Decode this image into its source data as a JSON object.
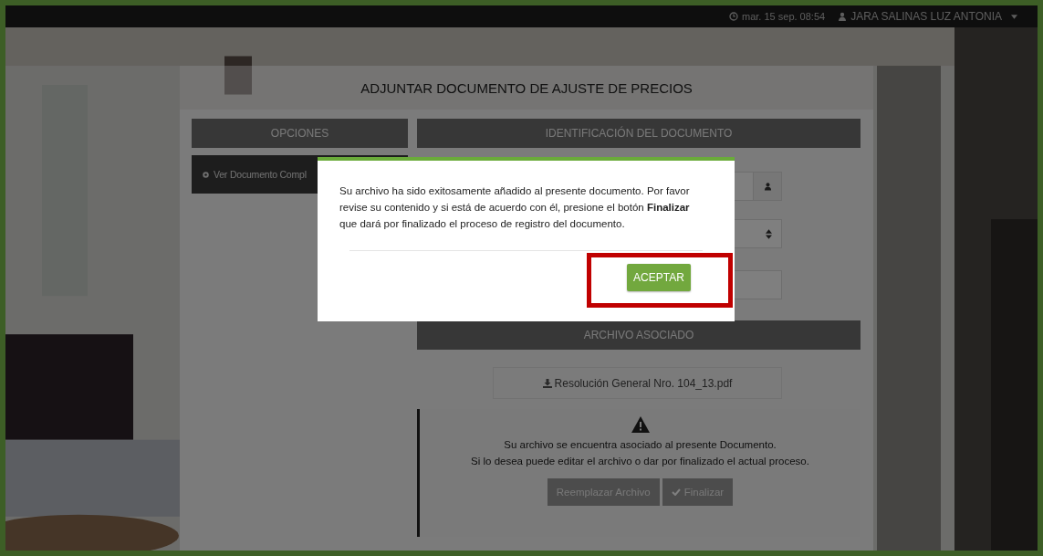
{
  "top_bar": {
    "datetime": "mar. 15 sep. 08:54",
    "user": "JARA SALINAS LUZ ANTONIA"
  },
  "page": {
    "title": "ADJUNTAR DOCUMENTO DE AJUSTE DE PRECIOS"
  },
  "options": {
    "header": "OPCIONES",
    "items": [
      {
        "label": "Ver Documento Compl"
      }
    ]
  },
  "identification": {
    "header": "IDENTIFICACIÓN DEL DOCUMENTO",
    "fields": [
      {
        "kind": "user"
      },
      {
        "kind": "select"
      },
      {
        "kind": "text"
      }
    ]
  },
  "attachment": {
    "header": "ARCHIVO ASOCIADO",
    "file": "Resolución General Nro. 104_13.pdf",
    "notice": [
      "Su archivo se encuentra asociado al presente Documento.",
      "Si lo desea puede editar el archivo o dar por finalizado el actual proceso."
    ],
    "buttons": [
      {
        "kind": "replace",
        "label": "Reemplazar Archivo"
      },
      {
        "kind": "finish",
        "label": "Finalizar"
      }
    ]
  },
  "modal": {
    "message": "Su archivo ha sido exitosamente añadido al presente documento. Por favor revise su contenido y si está de acuerdo con él, presione el botón **Finalizar** que dará por finalizado el proceso de registro del documento.",
    "button": "ACEPTAR",
    "highlighted": true
  }
}
